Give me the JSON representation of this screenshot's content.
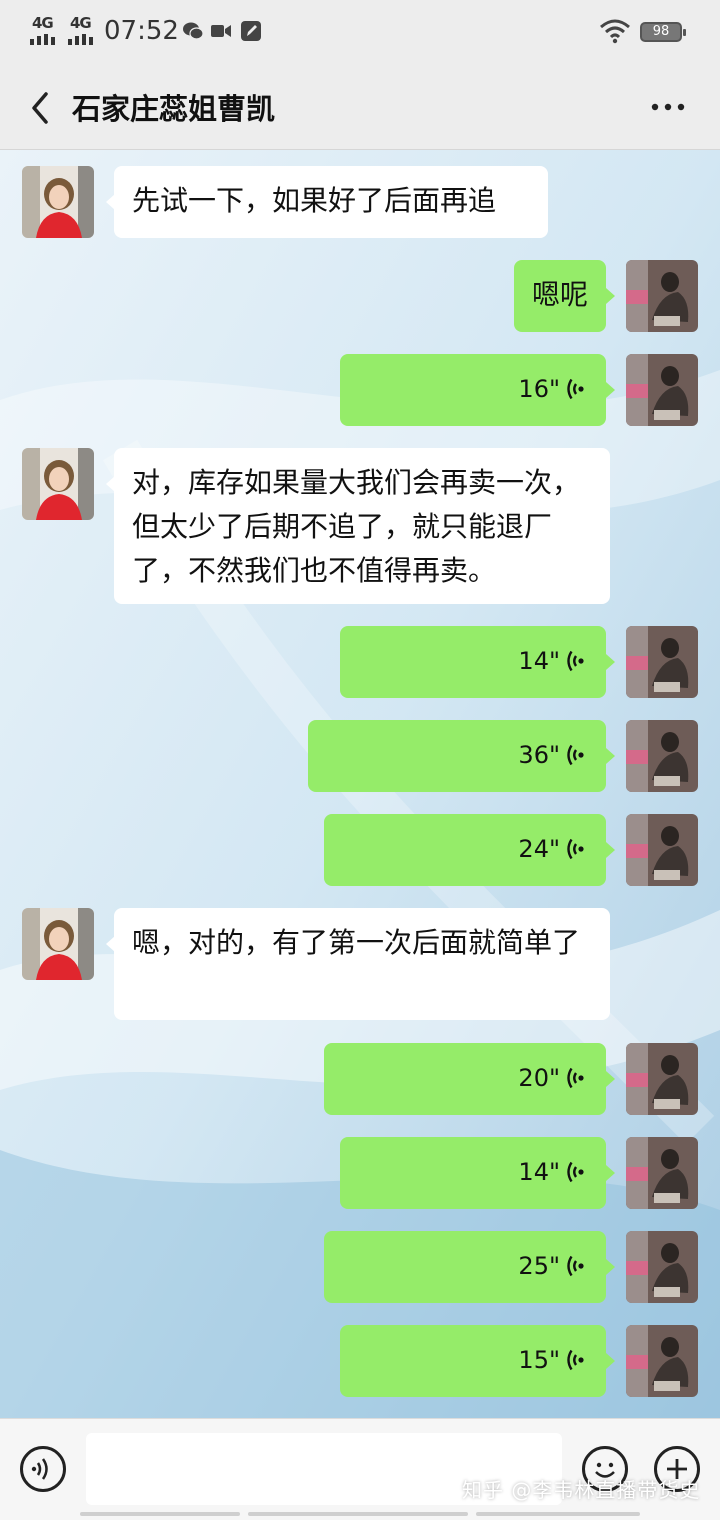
{
  "status_bar": {
    "signal_1": "4G",
    "signal_2": "4G",
    "time": "07:52",
    "battery": "98"
  },
  "header": {
    "title": "石家庄蕊姐曹凯",
    "back_icon": "chevron-left-icon",
    "more_icon": "more-dots-icon"
  },
  "messages": [
    {
      "side": "left",
      "type": "text",
      "text": "先试一下，如果好了后面再追"
    },
    {
      "side": "right",
      "type": "text",
      "text": "嗯呢"
    },
    {
      "side": "right",
      "type": "voice",
      "duration": "16\""
    },
    {
      "side": "left",
      "type": "text",
      "text": "对，库存如果量大我们会再卖一次，但太少了后期不追了，就只能退厂了，不然我们也不值得再卖。"
    },
    {
      "side": "right",
      "type": "voice",
      "duration": "14\""
    },
    {
      "side": "right",
      "type": "voice",
      "duration": "36\""
    },
    {
      "side": "right",
      "type": "voice",
      "duration": "24\""
    },
    {
      "side": "left",
      "type": "text",
      "text": "嗯，对的，有了第一次后面就简单了"
    },
    {
      "side": "right",
      "type": "voice",
      "duration": "20\""
    },
    {
      "side": "right",
      "type": "voice",
      "duration": "14\""
    },
    {
      "side": "right",
      "type": "voice",
      "duration": "25\""
    },
    {
      "side": "right",
      "type": "voice",
      "duration": "15\""
    }
  ],
  "input_bar": {
    "voice_icon": "voice-input-icon",
    "emoji_icon": "emoji-icon",
    "plus_icon": "plus-icon",
    "input_value": ""
  },
  "watermark": "知乎 @李韦林直播带货史",
  "colors": {
    "bubble_green": "#95ec69",
    "bubble_white": "#ffffff",
    "bar_gray": "#ededed"
  }
}
